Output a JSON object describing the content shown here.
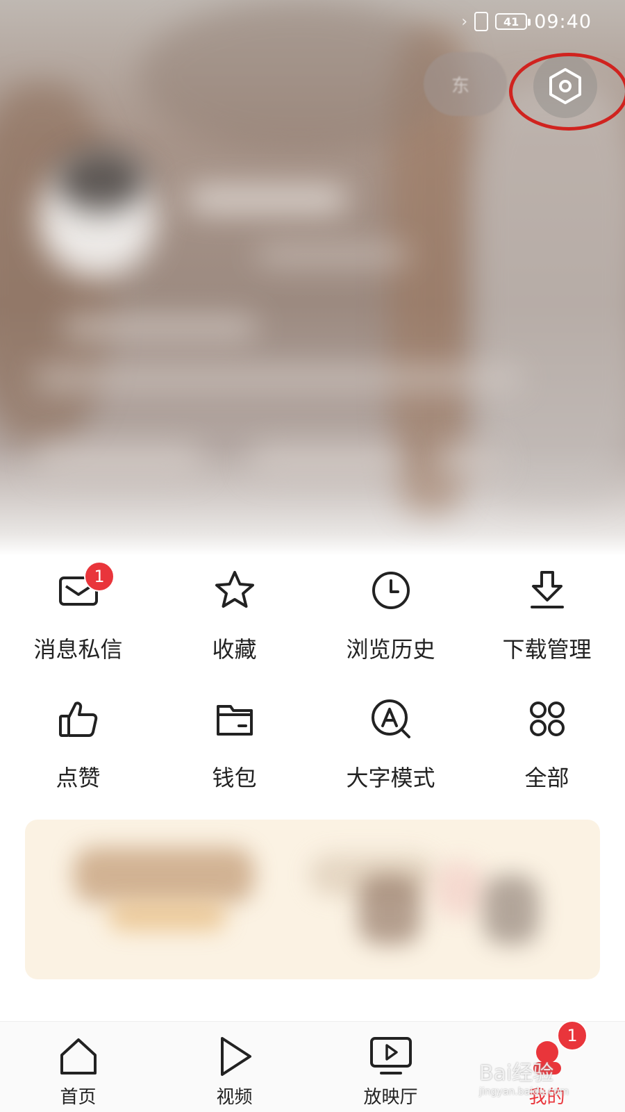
{
  "status_bar": {
    "battery": "41",
    "time": "09:40"
  },
  "top_pill": {
    "label": "东"
  },
  "grid": {
    "row1": [
      {
        "label": "消息私信",
        "icon": "mail-icon",
        "badge": "1"
      },
      {
        "label": "收藏",
        "icon": "star-icon"
      },
      {
        "label": "浏览历史",
        "icon": "clock-icon"
      },
      {
        "label": "下载管理",
        "icon": "download-icon"
      }
    ],
    "row2": [
      {
        "label": "点赞",
        "icon": "thumbs-up-icon"
      },
      {
        "label": "钱包",
        "icon": "wallet-icon"
      },
      {
        "label": "大字模式",
        "icon": "large-font-icon"
      },
      {
        "label": "全部",
        "icon": "grid-icon"
      }
    ]
  },
  "tabs": [
    {
      "label": "首页",
      "icon": "home-icon"
    },
    {
      "label": "视频",
      "icon": "play-icon"
    },
    {
      "label": "放映厅",
      "icon": "tv-play-icon"
    },
    {
      "label": "我的",
      "icon": "profile-icon",
      "badge": "1",
      "active": true
    }
  ],
  "watermark": {
    "text": "Bai经验",
    "sub": "jingyan.baidu.com"
  },
  "colors": {
    "accent": "#e9353b",
    "highlight_ring": "#d0231f"
  }
}
